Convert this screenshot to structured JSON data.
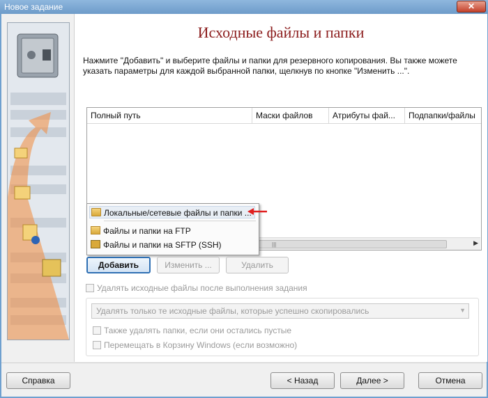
{
  "window": {
    "title": "Новое задание",
    "close_glyph": "✕"
  },
  "main": {
    "heading": "Исходные файлы и папки",
    "description": "Нажмите \"Добавить\" и выберите файлы и папки для резервного копирования. Вы также можете указать параметры для каждой выбранной папки, щелкнув по кнопке \"Изменить ...\"."
  },
  "table": {
    "columns": [
      "Полный путь",
      "Маски файлов",
      "Атрибуты фай...",
      "Подпапки/файлы"
    ]
  },
  "dropdown_menu": {
    "items": [
      {
        "label": "Локальные/сетевые файлы и папки ...",
        "icon": "folder-icon",
        "highlighted": true
      },
      {
        "label": "Файлы и папки на FTP",
        "icon": "ftp-icon",
        "highlighted": false
      },
      {
        "label": "Файлы и папки на SFTP (SSH)",
        "icon": "sftp-lock-icon",
        "highlighted": false
      }
    ]
  },
  "actions": {
    "add_label": "Добавить",
    "edit_label": "Изменить ...",
    "delete_label": "Удалить"
  },
  "options": {
    "delete_sources_label": "Удалять исходные файлы после выполнения задания",
    "delete_sources_checked": false,
    "delete_mode_value": "Удалять только те исходные файлы, которые успешно скопировались",
    "delete_empty_folders_label": "Также удалять папки, если они остались пустые",
    "recycle_bin_label": "Перемещать в Корзину Windows (если возможно)"
  },
  "footer": {
    "help_label": "Справка",
    "back_label": "< Назад",
    "next_label": "Далее >",
    "cancel_label": "Отмена"
  },
  "colors": {
    "heading": "#8b1c1c",
    "focus_border": "#2e6fb3",
    "arrow_red": "#e02020",
    "side_arrow": "#f28a3c"
  }
}
